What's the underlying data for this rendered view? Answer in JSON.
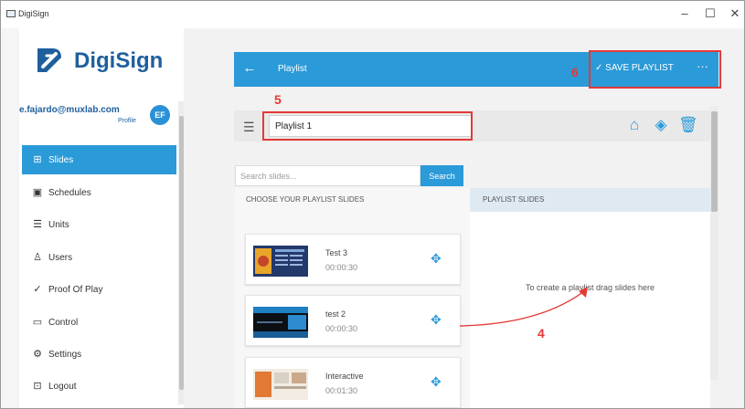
{
  "window": {
    "title": "DigiSign",
    "controls": [
      "–",
      "☐",
      "✕"
    ]
  },
  "sidebar": {
    "logo_text": "DigiSign",
    "user": {
      "email": "e.fajardo@muxlab.com",
      "profile_label": "Profile",
      "initials": "EF"
    },
    "items": [
      {
        "label": "Slides",
        "icon": "grid-icon",
        "active": true
      },
      {
        "label": "Schedules",
        "icon": "calendar-icon"
      },
      {
        "label": "Units",
        "icon": "server-icon"
      },
      {
        "label": "Users",
        "icon": "user-icon"
      },
      {
        "label": "Proof Of Play",
        "icon": "check-icon"
      },
      {
        "label": "Control",
        "icon": "monitor-icon"
      },
      {
        "label": "Settings",
        "icon": "gear-icon"
      },
      {
        "label": "Logout",
        "icon": "logout-icon"
      }
    ]
  },
  "topbar": {
    "title": "Playlist",
    "save_label": "SAVE PLAYLIST",
    "more": "···"
  },
  "playlist": {
    "name": "Playlist 1"
  },
  "search": {
    "placeholder": "Search slides...",
    "button": "Search"
  },
  "columns": {
    "left": "CHOOSE YOUR PLAYLIST SLIDES",
    "right": "PLAYLIST SLIDES"
  },
  "drop_hint": "To create a playlist drag slides here",
  "slides": [
    {
      "name": "Test 3",
      "duration": "00:00:30"
    },
    {
      "name": "test 2",
      "duration": "00:00:30"
    },
    {
      "name": "Interactive",
      "duration": "00:01:30"
    }
  ],
  "annotations": {
    "n4": "4",
    "n5": "5",
    "n6": "6"
  },
  "colors": {
    "accent": "#2b9ad8",
    "brand": "#1f5f9e",
    "annotation": "#e53935"
  }
}
